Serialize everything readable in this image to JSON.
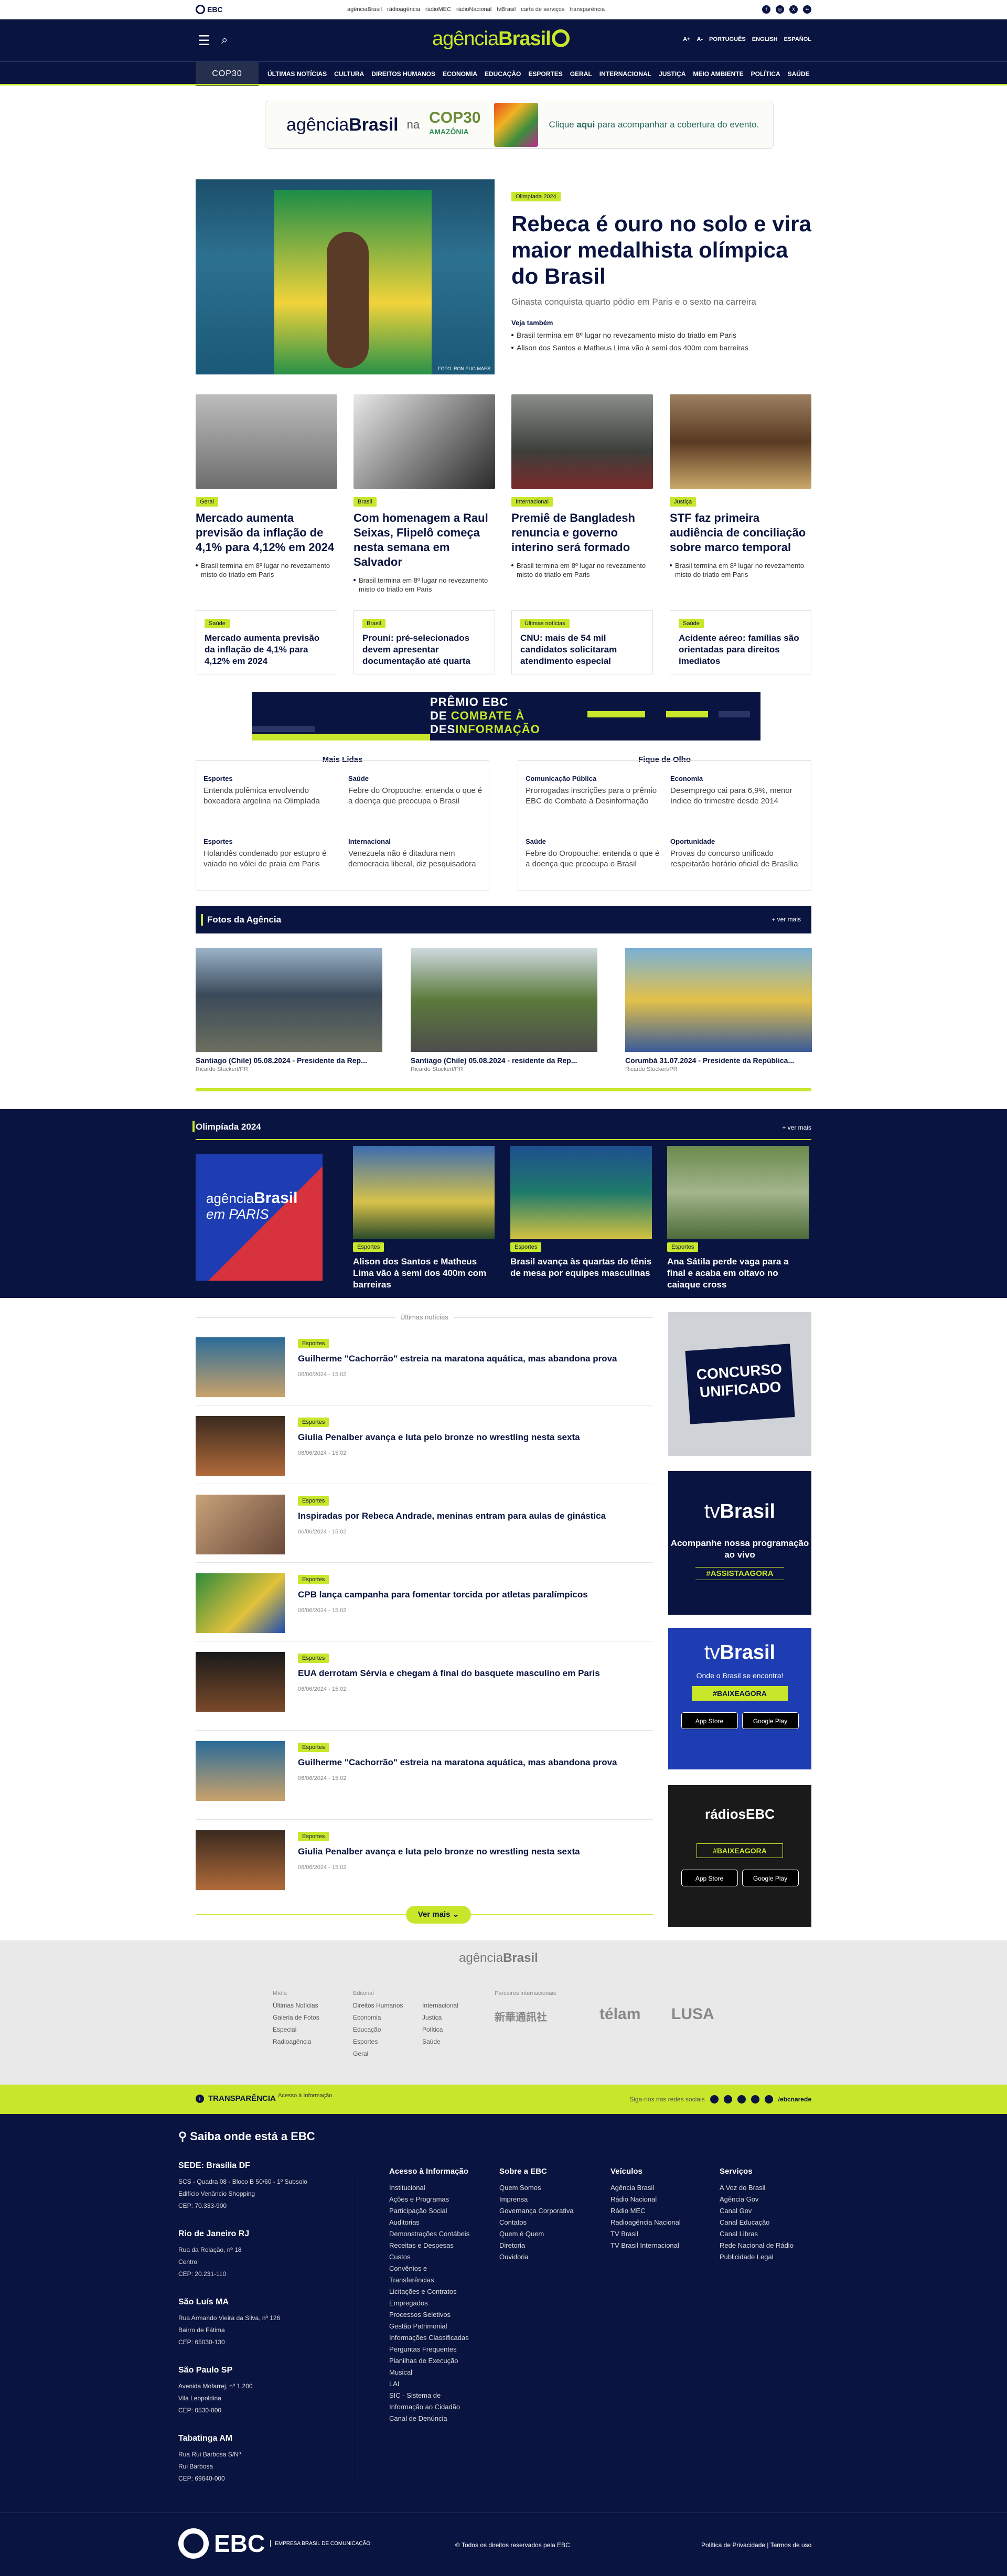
{
  "topbar": {
    "logo": "EBC",
    "links": [
      "agênciaBrasil",
      "rádioagência",
      "rádioMEC",
      "rádioNacional",
      "tvBrasil",
      "carta de serviços",
      "transparência"
    ]
  },
  "header": {
    "brand_light": "agência",
    "brand_bold": "Brasil",
    "langs": [
      "A+",
      "A-",
      "PORTUGUÊS",
      "ENGLISH",
      "ESPAÑOL"
    ]
  },
  "nav": {
    "cop": "COP30",
    "items": [
      "ÚLTIMAS NOTÍCIAS",
      "CULTURA",
      "DIREITOS HUMANOS",
      "ECONOMIA",
      "EDUCAÇÃO",
      "ESPORTES",
      "GERAL",
      "INTERNACIONAL",
      "JUSTIÇA",
      "MEIO AMBIENTE",
      "POLÍTICA",
      "SAÚDE"
    ]
  },
  "banner": {
    "brand_light": "agência",
    "brand_bold": "Brasil",
    "na": "na",
    "cop": "COP30",
    "amazonia": "AMAZÔNIA",
    "cta_pre": "Clique",
    "cta_bold": "aqui",
    "cta_post": "para acompanhar a cobertura do evento."
  },
  "hero": {
    "tag": "Olimpíada 2024",
    "title": "Rebeca é ouro no solo e vira maior medalhista olímpica do Brasil",
    "subtitle": "Ginasta conquista quarto pódio em Paris e o sexto na carreira",
    "see_also": "Veja também",
    "related": [
      "Brasil termina em 8º lugar no revezamento misto do triatlo em Paris",
      "Alison dos Santos e Matheus Lima vão à semi dos 400m com barreiras"
    ],
    "credit": "FOTO: RON PUG MAES"
  },
  "cards": [
    {
      "tag": "Geral",
      "title": "Mercado aumenta previsão da inflação de 4,1% para 4,12% em 2024",
      "rel": "Brasil termina em 8º lugar no revezamento misto do triatlo em Paris"
    },
    {
      "tag": "Brasil",
      "title": "Com homenagem a Raul Seixas, Flipelô começa nesta semana em Salvador",
      "rel": "Brasil termina em 8º lugar no revezamento misto do triatlo em Paris"
    },
    {
      "tag": "Internacional",
      "title": "Premiê de Bangladesh renuncia e governo interino será formado",
      "rel": "Brasil termina em 8º lugar no revezamento misto do triatlo em Paris"
    },
    {
      "tag": "Justiça",
      "title": "STF faz primeira audiência de conciliação sobre marco temporal",
      "rel": "Brasil termina em 8º lugar no revezamento misto do triatlo em Paris"
    }
  ],
  "boxes": [
    {
      "tag": "Saúde",
      "title": "Mercado aumenta previsão da inflação de 4,1% para 4,12% em 2024"
    },
    {
      "tag": "Brasil",
      "title": "Prouni: pré-selecionados devem apresentar documentação até quarta"
    },
    {
      "tag": "Últimas notícias",
      "title": "CNU: mais de 54 mil candidatos solicitaram atendimento especial"
    },
    {
      "tag": "Saúde",
      "title": "Acidente aéreo: famílias são orientadas para direitos imediatos"
    }
  ],
  "premio": {
    "l1": "PRÊMIO EBC",
    "l2a": "DE ",
    "l2b": "COMBATE À",
    "l3a": "DES",
    "l3b": "INFORMAÇÃO"
  },
  "mais_lidas": {
    "title": "Mais Lidas",
    "items": [
      {
        "cat": "Esportes",
        "desc": "Entenda polêmica envolvendo boxeadora argelina na Olimpíada"
      },
      {
        "cat": "Saúde",
        "desc": "Febre do Oropouche: entenda o que é a doença que preocupa o Brasil"
      },
      {
        "cat": "Esportes",
        "desc": "Holandês condenado por estupro é vaiado no vôlei de praia em Paris"
      },
      {
        "cat": "Internacional",
        "desc": "Venezuela não é ditadura nem democracia liberal, diz pesquisadora"
      }
    ]
  },
  "fique": {
    "title": "Fique de Olho",
    "items": [
      {
        "cat": "Comunicação Pública",
        "desc": "Prorrogadas inscrições para o prêmio EBC de Combate à Desinformação"
      },
      {
        "cat": "Economia",
        "desc": "Desemprego cai para 6,9%, menor índice do trimestre desde 2014"
      },
      {
        "cat": "Saúde",
        "desc": "Febre do Oropouche: entenda o que é a doença que preocupa o Brasil"
      },
      {
        "cat": "Oportunidade",
        "desc": "Provas do concurso unificado respeitarão horário oficial de Brasília"
      }
    ]
  },
  "fotos": {
    "title": "Fotos da Agência",
    "mais": "+ ver mais",
    "items": [
      {
        "cap": "Santiago (Chile) 05.08.2024 - Presidente da Rep...",
        "cr": "Ricardo Stuckert/PR"
      },
      {
        "cap": "Santiago (Chile) 05.08.2024 - residente da Rep...",
        "cr": "Ricardo Stuckert/PR"
      },
      {
        "cap": "Corumbá 31.07.2024 - Presidente da República...",
        "cr": "Ricardo Stuckert/PR"
      }
    ]
  },
  "olimp": {
    "title": "Olimpíada 2024",
    "mais": "+ ver mais",
    "paris1": "agência",
    "paris2": "Brasil",
    "paris3": "em PARIS",
    "items": [
      {
        "tag": "Esportes",
        "title": "Alison dos Santos e Matheus Lima vão à semi dos 400m com barreiras"
      },
      {
        "tag": "Esportes",
        "title": "Brasil avança às quartas do tênis de mesa por equipes masculinas"
      },
      {
        "tag": "Esportes",
        "title": "Ana Sátila perde vaga para a final e acaba em oitavo no caiaque cross"
      }
    ]
  },
  "ultimas": {
    "title": "Últimas notícias",
    "items": [
      {
        "tag": "Esportes",
        "title": "Guilherme \"Cachorrão\" estreia na maratona aquática, mas abandona prova",
        "date": "06/06/2024 - 15:02"
      },
      {
        "tag": "Esportes",
        "title": "Giulia Penalber avança e luta pelo bronze no wrestling nesta sexta",
        "date": "06/06/2024 - 15:02"
      },
      {
        "tag": "Esportes",
        "title": "Inspiradas por Rebeca Andrade, meninas entram para aulas de ginástica",
        "date": "06/06/2024 - 15:02"
      },
      {
        "tag": "Esportes",
        "title": "CPB lança campanha para fomentar torcida por atletas paralímpicos",
        "date": "06/06/2024 - 15:02"
      },
      {
        "tag": "Esportes",
        "title": "EUA derrotam Sérvia e chegam à final do basquete masculino em Paris",
        "date": "06/06/2024 - 15:02"
      },
      {
        "tag": "Esportes",
        "title": "Guilherme \"Cachorrão\" estreia na maratona aquática, mas abandona prova",
        "date": "06/06/2024 - 15:02"
      },
      {
        "tag": "Esportes",
        "title": "Giulia Penalber avança e luta pelo bronze no wrestling nesta sexta",
        "date": "06/06/2024 - 15:02"
      }
    ],
    "more": "Ver mais ⌄"
  },
  "ads": {
    "concurso": "CONCURSO UNIFICADO",
    "tv_light": "tv",
    "tv_bold": "Brasil",
    "tv_text": "Acompanhe nossa programação ao vivo",
    "tv_cta": "#ASSISTAAGORA",
    "play_text": "Onde o Brasil se encontra!",
    "play_cta": "#BAIXEAGORA",
    "appstore": "App Store",
    "googleplay": "Google Play",
    "radios": "rádiosEBC",
    "radios_cta": "#BAIXEAGORA"
  },
  "fgrey": {
    "logo_light": "agência",
    "logo_bold": "Brasil",
    "c1": [
      "Mídia",
      "Últimas Notícias",
      "Galeria de Fotos",
      "Especial",
      "Radioagência"
    ],
    "c2h": "Editorial",
    "c2": [
      "Direitos Humanos",
      "Economia",
      "Educação",
      "Esportes",
      "Geral"
    ],
    "c3": [
      "Internacional",
      "Justiça",
      "Política",
      "Saúde"
    ],
    "partners_h": "Parceiros internacionais",
    "partners": [
      "新華通訊社",
      "télam",
      "LUSA"
    ]
  },
  "transp": {
    "title": "TRANSPARÊNCIA",
    "sub": "Acesso à Informação",
    "social": "Siga-nos nas redes sociais",
    "handle": "/ebcnarede"
  },
  "fdark": {
    "saiba": "Saiba onde está a EBC",
    "locs": [
      {
        "h": "SEDE: Brasília DF",
        "d": [
          "SCS - Quadra 08 - Bloco B 50/60 - 1º Subsolo",
          "Edifício Venâncio Shopping",
          "CEP: 70.333-900"
        ]
      },
      {
        "h": "Rio de Janeiro RJ",
        "d": [
          "Rua da Relação, nº 18",
          "Centro",
          "CEP: 20.231-110"
        ]
      },
      {
        "h": "São Luís MA",
        "d": [
          "Rua Armando Vieira da Silva, nº 126",
          "Bairro de Fátima",
          "CEP: 65030-130"
        ]
      },
      {
        "h": "São Paulo SP",
        "d": [
          "Avenida Mofarrej, nº 1.200",
          "Vila Leopoldina",
          "CEP: 0530-000"
        ]
      },
      {
        "h": "Tabatinga AM",
        "d": [
          "Rua Rui Barbosa S/Nº",
          "Rui Barbosa",
          "CEP: 69640-000"
        ]
      }
    ],
    "cols": [
      {
        "h": "Acesso à Informação",
        "items": [
          "Institucional",
          "Ações e Programas",
          "Participação Social",
          "Auditorias",
          "Demonstrações Contábeis",
          "Receitas e Despesas",
          "Custos",
          "Convênios e Transferências",
          "Licitações e Contratos",
          "Empregados",
          "Processos Seletivos",
          "Gestão Patrimonial",
          "Informações Classificadas",
          "Perguntas Frequentes",
          "Planilhas de Execução Musical",
          "LAI",
          "SIC - Sistema de Informação ao Cidadão",
          "Canal de Denúncia"
        ]
      },
      {
        "h": "Sobre a EBC",
        "items": [
          "Quem Somos",
          "Imprensa",
          "Governança Corporativa",
          "Contatos",
          "Quem é Quem",
          "Diretoria",
          "Ouvidoria"
        ]
      },
      {
        "h": "Veículos",
        "items": [
          "Agência Brasil",
          "Rádio Nacional",
          "Rádio MEC",
          "Radioagência Nacional",
          "TV Brasil",
          "TV Brasil Internacional"
        ]
      },
      {
        "h": "Serviços",
        "items": [
          "A Voz do Brasil",
          "Agência Gov",
          "Canal Gov",
          "Canal Educação",
          "Canal Libras",
          "Rede Nacional de Rádio",
          "Publicidade Legal"
        ]
      }
    ],
    "ebc": "EBC",
    "ebc_sub": "EMPRESA BRASIL DE COMUNICAÇÃO",
    "copy": "© Todos os direitos reservados pela EBC",
    "pol": "Política de Privacidade | Termos de uso"
  }
}
